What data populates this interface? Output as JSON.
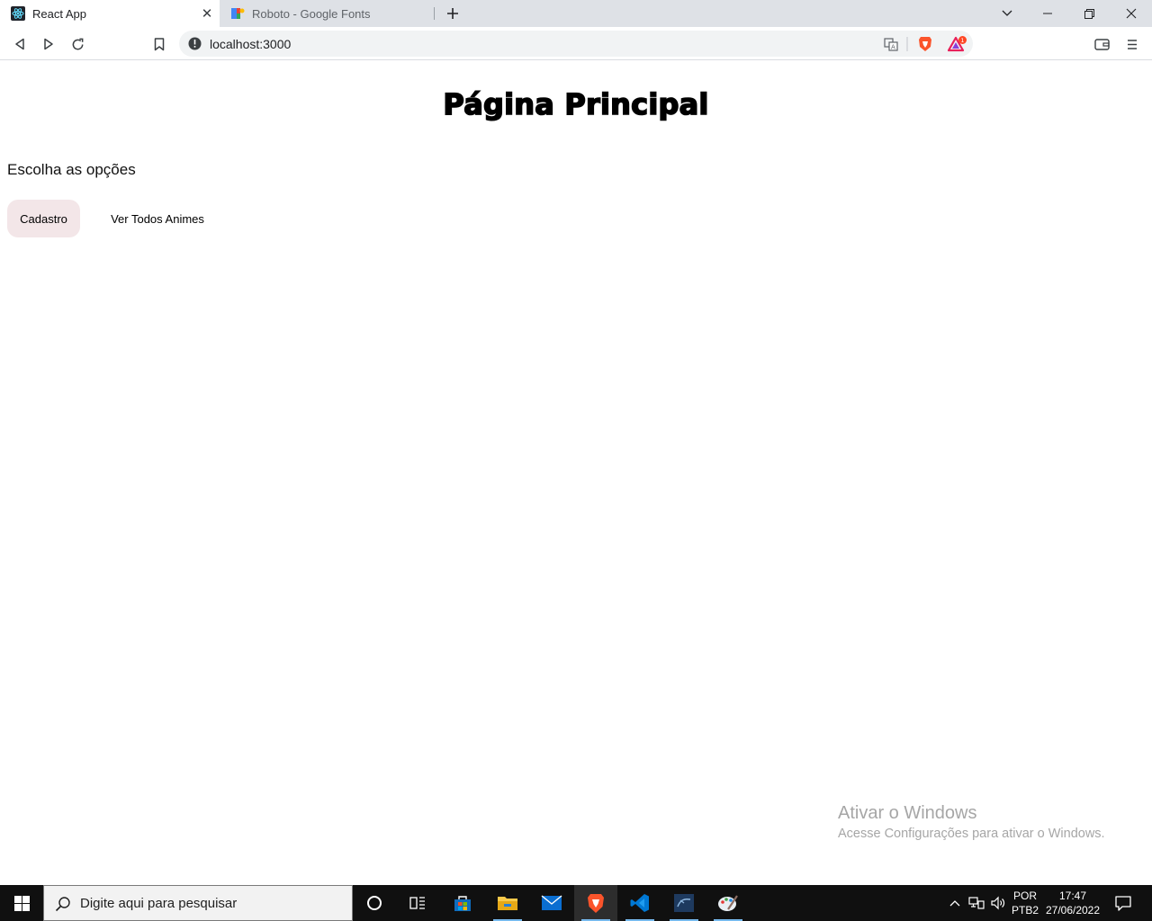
{
  "browser": {
    "tabs": [
      {
        "title": "React App",
        "active": true,
        "favicon": "react-icon"
      },
      {
        "title": "Roboto - Google Fonts",
        "active": false,
        "favicon": "google-fonts-icon"
      }
    ],
    "address": "localhost:3000",
    "rewards_badge": "1"
  },
  "page": {
    "title": "Página Principal",
    "subtitle": "Escolha as opções",
    "buttons": [
      {
        "label": "Cadastro"
      },
      {
        "label": "Ver Todos Animes"
      }
    ]
  },
  "watermark": {
    "line1": "Ativar o Windows",
    "line2": "Acesse Configurações para ativar o Windows."
  },
  "taskbar": {
    "search_placeholder": "Digite aqui para pesquisar",
    "language_line1": "POR",
    "language_line2": "PTB2",
    "time": "17:47",
    "date": "27/06/2022",
    "pinned": [
      "cortana-icon",
      "task-view-icon",
      "microsoft-store-icon",
      "file-explorer-icon",
      "mail-icon",
      "brave-icon",
      "vscode-icon",
      "mysql-workbench-icon",
      "paint-icon"
    ]
  },
  "colors": {
    "tabstrip": "#dee1e6",
    "button_bg": "#f3e6e8",
    "taskbar": "#101010",
    "watermark": "#a6a6a6"
  }
}
